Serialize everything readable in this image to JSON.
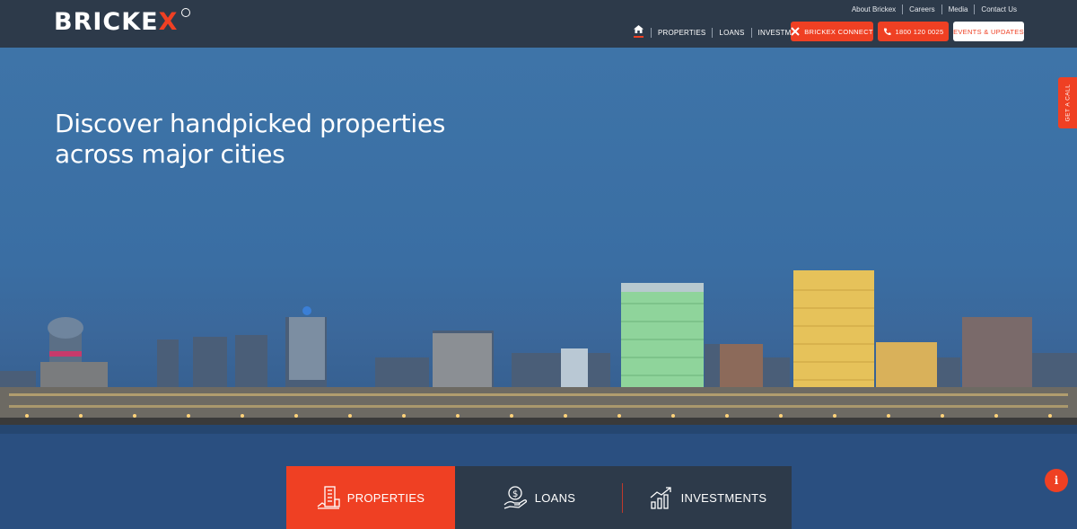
{
  "brand": {
    "name_main": "BRICKE",
    "name_x": "X",
    "tm": "TM"
  },
  "top_links": [
    "About Brickex",
    "Careers",
    "Media",
    "Contact Us"
  ],
  "main_nav": [
    "PROPERTIES",
    "LOANS",
    "INVESTMENTS"
  ],
  "buttons": {
    "connect": "BRICKEX CONNECT",
    "phone": "1800 120 0025",
    "events": "EVENTS & UPDATES"
  },
  "hero": {
    "headline_line1": "Discover handpicked properties",
    "headline_line2": "across major cities"
  },
  "side_tab": {
    "get_call": "GET A CALL"
  },
  "info_button": {
    "label": "i"
  },
  "tabs": [
    {
      "label": "PROPERTIES",
      "icon": "building-icon"
    },
    {
      "label": "LOANS",
      "icon": "money-hand-icon"
    },
    {
      "label": "INVESTMENTS",
      "icon": "growth-chart-icon"
    }
  ],
  "colors": {
    "accent": "#ef4023",
    "header_bg": "#2d3a4a",
    "sky": "#3e74a8"
  }
}
